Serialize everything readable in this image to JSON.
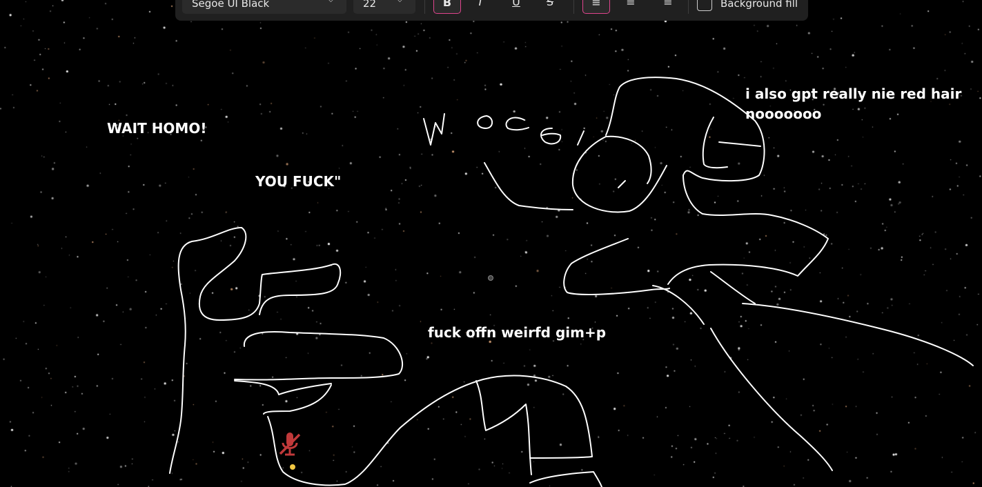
{
  "toolbar": {
    "font_name": "Segoe UI Black",
    "font_size": "22",
    "bold_icon": "bold-icon",
    "italic_icon": "italic-icon",
    "underline_icon": "underline-icon",
    "strike_icon": "strikethrough-icon",
    "bg_fill_label": "Background fill",
    "bg_fill_checked": false
  },
  "annotations": [
    "WAIT HOMO!",
    "YOU FUCK\"",
    "i  also gpt really nie red hair",
    "nooooooo",
    "fuck offn weirfd gim+p"
  ],
  "colors": {
    "background": "#000000",
    "ink": "#ffffff",
    "toolbar_bg": "#202020",
    "accent": "#e0458e",
    "mic_muted": "#c0393a"
  }
}
